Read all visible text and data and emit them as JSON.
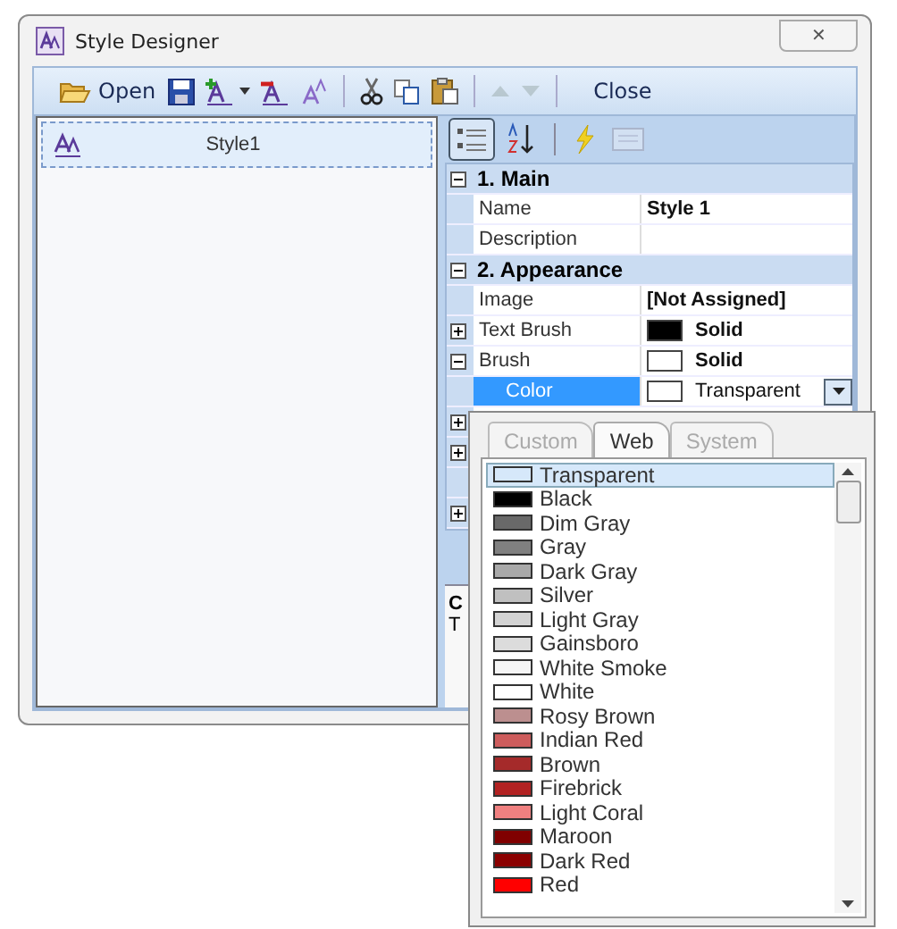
{
  "window": {
    "title": "Style Designer",
    "close_glyph": "✕"
  },
  "toolbar": {
    "open_label": "Open",
    "close_label": "Close",
    "move_up_disabled": true,
    "move_down_disabled": true
  },
  "styles": [
    {
      "name": "Style1",
      "selected": true
    }
  ],
  "grid_toolbar": {
    "categorized_selected": true
  },
  "grid": [
    {
      "kind": "category",
      "label": "1. Main",
      "expanded": true
    },
    {
      "kind": "property",
      "name": "Name",
      "value": "Style 1",
      "selected": false
    },
    {
      "kind": "property",
      "name": "Description",
      "selected": false
    },
    {
      "kind": "category",
      "label": "2. Appearance",
      "expanded": true
    },
    {
      "kind": "property",
      "name": "Image",
      "value": "[Not Assigned]",
      "selected": false
    },
    {
      "kind": "brush",
      "name": "Text Brush",
      "value": "Solid",
      "color": "#000000",
      "expanded": false,
      "selected": false
    },
    {
      "kind": "brush",
      "name": "Brush",
      "value": "Solid",
      "color": "#ffffff",
      "expanded": true,
      "selected": false
    },
    {
      "kind": "color",
      "name": "Color",
      "value": "Transparent",
      "color": "#ffffff",
      "selected": true
    },
    {
      "kind": "hidden",
      "expanded": false
    },
    {
      "kind": "hidden",
      "expanded": false
    },
    {
      "kind": "gap"
    },
    {
      "kind": "hidden",
      "expanded": false
    }
  ],
  "description": {
    "title": "C",
    "text": "T"
  },
  "color_picker": {
    "tabs": [
      {
        "label": "Custom",
        "selected": false
      },
      {
        "label": "Web",
        "selected": true
      },
      {
        "label": "System",
        "selected": false
      }
    ],
    "colors": [
      {
        "name": "Transparent",
        "selected": true
      },
      {
        "name": "Black",
        "color": "#000000",
        "selected": false
      },
      {
        "name": "Dim Gray",
        "color": "#696969",
        "selected": false
      },
      {
        "name": "Gray",
        "color": "#808080",
        "selected": false
      },
      {
        "name": "Dark Gray",
        "color": "#a9a9a9",
        "selected": false
      },
      {
        "name": "Silver",
        "color": "#c0c0c0",
        "selected": false
      },
      {
        "name": "Light Gray",
        "color": "#d3d3d3",
        "selected": false
      },
      {
        "name": "Gainsboro",
        "color": "#dcdcdc",
        "selected": false
      },
      {
        "name": "White Smoke",
        "color": "#f5f5f5",
        "selected": false
      },
      {
        "name": "White",
        "color": "#ffffff",
        "selected": false
      },
      {
        "name": "Rosy Brown",
        "color": "#bc8f8f",
        "selected": false
      },
      {
        "name": "Indian Red",
        "color": "#cd5c5c",
        "selected": false
      },
      {
        "name": "Brown",
        "color": "#a52a2a",
        "selected": false
      },
      {
        "name": "Firebrick",
        "color": "#b22222",
        "selected": false
      },
      {
        "name": "Light Coral",
        "color": "#f08080",
        "selected": false
      },
      {
        "name": "Maroon",
        "color": "#800000",
        "selected": false
      },
      {
        "name": "Dark Red",
        "color": "#8b0000",
        "selected": false
      },
      {
        "name": "Red",
        "color": "#ff0000",
        "selected": false
      }
    ]
  }
}
